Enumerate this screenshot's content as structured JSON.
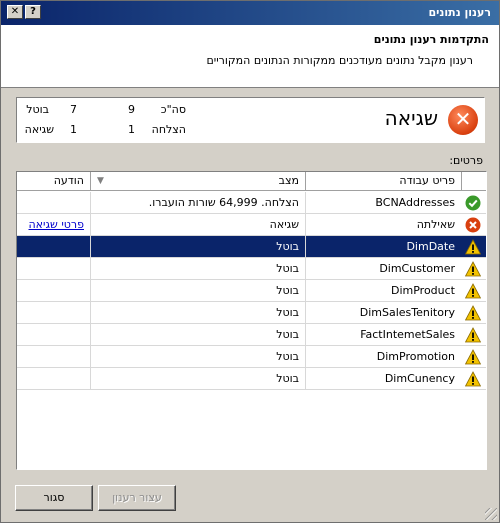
{
  "window": {
    "title": "רענון נתונים"
  },
  "titlebar": {
    "close_glyph": "✕",
    "help_glyph": "?"
  },
  "header": {
    "title": "התקדמות רענון נתונים",
    "subtitle": "רענון מקבל נתונים מעודכנים ממקורות הנתונים המקוריים"
  },
  "summary": {
    "status": "שגיאה",
    "total_label": "סה\"כ",
    "total_value": "9",
    "cancelled_label": "בוטל",
    "cancelled_value": "7",
    "success_label": "הצלחה",
    "success_value": "1",
    "error_label": "שגיאה",
    "error_value": "1"
  },
  "details": {
    "label": "פרטים:",
    "columns": {
      "item": "פריט עבודה",
      "status": "מצב",
      "message": "הודעה"
    },
    "rows": [
      {
        "icon": "success-icon",
        "name": "BCNAddresses",
        "status": "הצלחה. 64,999 שורות הועברו.",
        "message": ""
      },
      {
        "icon": "error-icon",
        "name": "שאילתה",
        "status": "שגיאה",
        "message": "פרטי שגיאה"
      },
      {
        "icon": "warning-icon",
        "name": "DimDate",
        "status": "בוטל",
        "message": ""
      },
      {
        "icon": "warning-icon",
        "name": "DimCustomer",
        "status": "בוטל",
        "message": ""
      },
      {
        "icon": "warning-icon",
        "name": "DimProduct",
        "status": "בוטל",
        "message": ""
      },
      {
        "icon": "warning-icon",
        "name": "DimSalesTenitory",
        "status": "בוטל",
        "message": ""
      },
      {
        "icon": "warning-icon",
        "name": "FactIntemetSales",
        "status": "בוטל",
        "message": ""
      },
      {
        "icon": "warning-icon",
        "name": "DimPromotion",
        "status": "בוטל",
        "message": ""
      },
      {
        "icon": "warning-icon",
        "name": "DimCunency",
        "status": "בוטל",
        "message": ""
      }
    ]
  },
  "buttons": {
    "close": "סגור",
    "stop_refresh": "עצור רענון"
  },
  "colors": {
    "selection": "#0a246a",
    "link": "#0000cc",
    "error": "#d9400f",
    "success": "#3a9a2a",
    "warning": "#f2c200"
  }
}
